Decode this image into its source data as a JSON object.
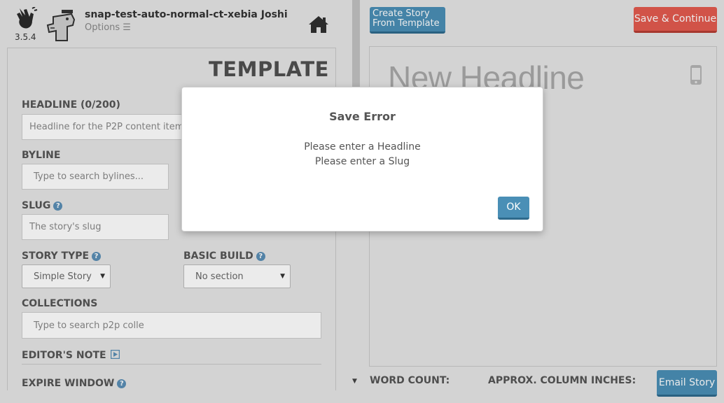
{
  "header": {
    "version": "3.5.4",
    "username": "snap-test-auto-normal-ct-xebia Joshi",
    "options_label": "Options ☰"
  },
  "template_form": {
    "title": "TEMPLATE",
    "headline": {
      "label": "HEADLINE (0/200)",
      "placeholder": "Headline for the P2P content item"
    },
    "byline": {
      "label": "BYLINE",
      "placeholder": "Type to search bylines..."
    },
    "slug": {
      "label": "SLUG",
      "placeholder": "The story's slug"
    },
    "story_type": {
      "label": "STORY TYPE",
      "selected": "Simple Story"
    },
    "basic_build": {
      "label": "BASIC BUILD",
      "selected": "No section"
    },
    "collections": {
      "label": "COLLECTIONS",
      "placeholder": "Type to search p2p colle"
    },
    "editors_note": {
      "label": "EDITOR'S NOTE"
    },
    "expire_window": {
      "label": "EXPIRE WINDOW"
    },
    "help_glyph": "?"
  },
  "right_panel": {
    "create_from_template_label": "Create Story From Template",
    "save_continue_label": "Save & Continue",
    "preview_headline": "New Headline",
    "word_count_label": "WORD COUNT:",
    "column_inches_label": "APPROX. COLUMN INCHES:",
    "email_story_label": "Email Story"
  },
  "modal": {
    "title": "Save Error",
    "messages": [
      "Please enter a Headline",
      "Please enter a Slug"
    ],
    "ok_label": "OK"
  },
  "icons": {
    "logo": "snap-hand-icon",
    "avatar": "dinosaur-avatar",
    "home": "home-icon",
    "phone": "mobile-phone-icon",
    "help": "help-icon",
    "play": "play-icon"
  },
  "colors": {
    "accent_blue": "#4a8fb6",
    "save_red": "#e35b4f",
    "background": "#e5e5e5"
  }
}
